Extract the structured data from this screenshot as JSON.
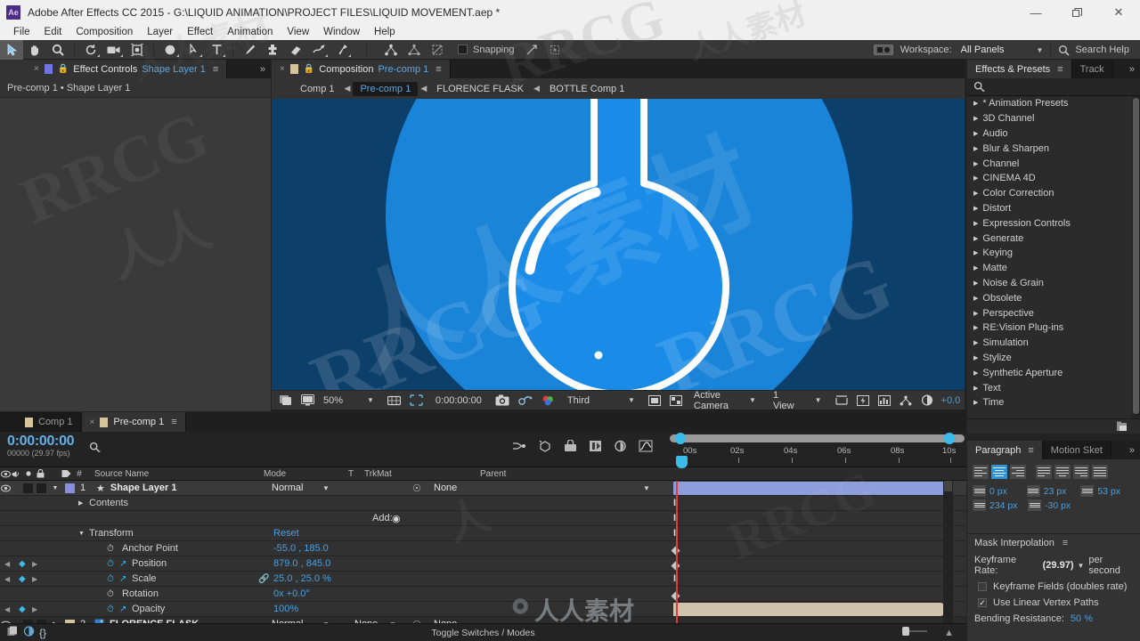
{
  "window": {
    "app_icon": "Ae",
    "title": "Adobe After Effects CC 2015 - G:\\LIQUID ANIMATION\\PROJECT FILES\\LIQUID MOVEMENT.aep *",
    "minimize": "—",
    "restore": "❐",
    "close": "✕"
  },
  "menu": {
    "items": [
      "File",
      "Edit",
      "Composition",
      "Layer",
      "Effect",
      "Animation",
      "View",
      "Window",
      "Help"
    ]
  },
  "toolbar": {
    "tools": [
      {
        "name": "selection-tool",
        "glyph": "➤"
      },
      {
        "name": "hand-tool",
        "glyph": "✋"
      },
      {
        "name": "zoom-tool",
        "glyph": "ὐd"
      },
      {
        "name": "rotation-tool",
        "glyph": "↻"
      },
      {
        "name": "camera-tool",
        "glyph": "Ἲ5"
      },
      {
        "name": "pan-behind-tool",
        "glyph": "⌘"
      },
      {
        "name": "shape-tool",
        "glyph": "●"
      },
      {
        "name": "pen-tool",
        "glyph": "✒"
      },
      {
        "name": "type-tool",
        "glyph": "T"
      },
      {
        "name": "brush-tool",
        "glyph": "╱"
      },
      {
        "name": "clone-stamp-tool",
        "glyph": "⬆"
      },
      {
        "name": "eraser-tool",
        "glyph": "▱"
      },
      {
        "name": "roto-brush-tool",
        "glyph": "✉"
      },
      {
        "name": "puppet-pin-tool",
        "glyph": "✦"
      }
    ],
    "rig_tools": [
      {
        "name": "puppet-overlap-tool"
      },
      {
        "name": "puppet-starch-tool"
      },
      {
        "name": "mask-tool"
      }
    ],
    "snapping_label": "Snapping",
    "workspace_label": "Workspace:",
    "workspace_value": "All Panels",
    "search_help": "Search Help"
  },
  "effect_controls": {
    "tab_close": "×",
    "tab_title": "Effect Controls",
    "tab_subject": "Shape Layer 1",
    "menu_glyph": "≡",
    "expand_glyph": "»",
    "breadcrumb": "Pre-comp 1 • Shape Layer 1"
  },
  "composition": {
    "tab_close": "×",
    "tab_title": "Composition",
    "tab_subject": "Pre-comp 1",
    "menu_glyph": "≡",
    "breadcrumbs": [
      {
        "label": "Comp 1",
        "active": false
      },
      {
        "label": "Pre-comp 1",
        "active": true
      },
      {
        "label": "FLORENCE FLASK",
        "active": false
      },
      {
        "label": "BOTTLE Comp 1",
        "active": false
      }
    ],
    "crumb_arrow": "◀",
    "bottom_bar": {
      "zoom": "50%",
      "timecode": "0:00:00:00",
      "resolution": "Third",
      "view_layout_camera": "Active Camera",
      "view_count": "1 View",
      "exposure": "+0.0"
    },
    "artwork": {
      "background_color": "#0d3f6b",
      "circle_color": "#1a84d8",
      "flask_fill": "#1a8ce8",
      "flask_stroke": "#ffffff",
      "highlight_color": "#ffffff"
    }
  },
  "effects_presets": {
    "tab_title": "Effects & Presets",
    "menu_glyph": "≡",
    "other_tab": "Track",
    "expand_glyph": "»",
    "search_icon": "search-icon",
    "categories": [
      "* Animation Presets",
      "3D Channel",
      "Audio",
      "Blur & Sharpen",
      "Channel",
      "CINEMA 4D",
      "Color Correction",
      "Distort",
      "Expression Controls",
      "Generate",
      "Keying",
      "Matte",
      "Noise & Grain",
      "Obsolete",
      "Perspective",
      "RE:Vision Plug-ins",
      "Simulation",
      "Stylize",
      "Synthetic Aperture",
      "Text",
      "Time"
    ]
  },
  "paragraph": {
    "tab_title": "Paragraph",
    "menu_glyph": "≡",
    "other_tab": "Motion Sket",
    "expand_glyph": "»",
    "align_buttons": [
      {
        "name": "align-left",
        "selected": false
      },
      {
        "name": "align-center",
        "selected": true
      },
      {
        "name": "align-right",
        "selected": false
      },
      {
        "name": "justify-last-left",
        "selected": false
      },
      {
        "name": "justify-last-center",
        "selected": false
      },
      {
        "name": "justify-last-right",
        "selected": false
      },
      {
        "name": "justify-all",
        "selected": false
      }
    ],
    "indent_left": "0 px",
    "indent_right": "23 px",
    "space_before": "53 px",
    "first_line_indent": "234 px",
    "space_after": "-30 px"
  },
  "mask_interpolation": {
    "title": "Mask Interpolation",
    "menu_glyph": "≡",
    "keyframe_rate_label": "Keyframe Rate:",
    "keyframe_rate_value": "(29.97)",
    "per_second": "per second",
    "keyframe_fields_label": "Keyframe Fields (doubles rate)",
    "keyframe_fields_checked": false,
    "linear_vertex_label": "Use Linear Vertex Paths",
    "linear_vertex_checked": true,
    "bending_label": "Bending Resistance:",
    "bending_value": "50 %"
  },
  "timeline": {
    "tabs": [
      {
        "label": "Comp 1",
        "active": false,
        "closable": false
      },
      {
        "label": "Pre-comp 1",
        "active": true,
        "closable": true
      }
    ],
    "tab_close": "×",
    "menu_glyph": "≡",
    "timecode": "0:00:00:00",
    "frames": "00000 (29.97 fps)",
    "search_icon": "search-icon",
    "ruler_labels": [
      "00s",
      "02s",
      "04s",
      "06s",
      "08s",
      "10s"
    ],
    "columns": [
      "#",
      "Source Name",
      "Mode",
      "T",
      "TrkMat",
      "Parent"
    ],
    "footer": "Toggle Switches / Modes",
    "layers": [
      {
        "index": "1",
        "name": "Shape Layer 1",
        "mode": "Normal",
        "trkmat": "",
        "parent": "None",
        "selected": true,
        "bar_color": "#8e9edd",
        "star": "★",
        "swatch": "#8a8ee0",
        "type_icon": "shape-layer-icon"
      },
      {
        "index": "2",
        "name": "FLORENCE FLASK",
        "mode": "Normal",
        "trkmat": "None",
        "parent": "None",
        "selected": false,
        "bar_color": "#cfc3ad",
        "swatch": "#d6c49d",
        "type_icon": "comp-layer-icon"
      }
    ],
    "properties": [
      {
        "label": "Contents",
        "value": "",
        "indent": 78,
        "twirl": "▶",
        "add_label": "Add:",
        "stopwatch": false,
        "keyframed": false
      },
      {
        "label": "Transform",
        "value": "Reset",
        "indent": 78,
        "twirl": "▼",
        "stopwatch": false,
        "keyframed": false
      },
      {
        "label": "Anchor Point",
        "value": "-55.0 , 185.0",
        "indent": 118,
        "stopwatch": true,
        "keyframed": false
      },
      {
        "label": "Position",
        "value": "879.0 , 845.0",
        "indent": 118,
        "stopwatch": true,
        "keyframed": true
      },
      {
        "label": "Scale",
        "value": "25.0 , 25.0 %",
        "indent": 118,
        "stopwatch": true,
        "keyframed": true,
        "link_icon": true
      },
      {
        "label": "Rotation",
        "value": "0x +0.0°",
        "indent": 118,
        "stopwatch": true,
        "keyframed": false
      },
      {
        "label": "Opacity",
        "value": "100%",
        "indent": 118,
        "stopwatch": true,
        "keyframed": true
      }
    ]
  },
  "watermarks": {
    "rrcg": "RRCG",
    "cn": "人人素材"
  }
}
